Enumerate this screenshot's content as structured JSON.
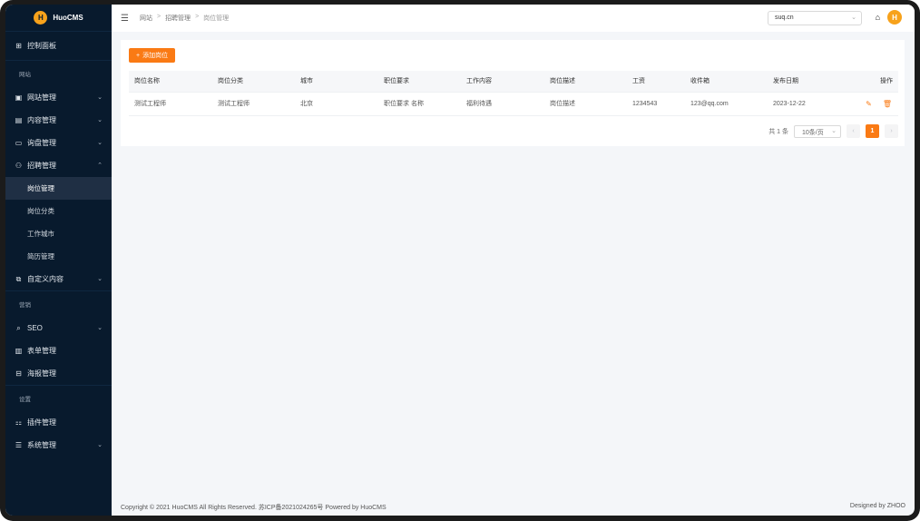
{
  "brand": {
    "name": "HuoCMS",
    "logo_glyph": "H"
  },
  "sidebar": {
    "dashboard": "控制面板",
    "section_site": "网站",
    "site_mgmt": "网站管理",
    "content_mgmt": "内容管理",
    "inquiry_mgmt": "询盘管理",
    "recruit_mgmt": "招聘管理",
    "recruit_children": [
      "岗位管理",
      "岗位分类",
      "工作城市",
      "简历管理"
    ],
    "custom_content": "自定义内容",
    "section_marketing": "营销",
    "seo": "SEO",
    "form_mgmt": "表单管理",
    "poster_mgmt": "海报管理",
    "section_settings": "设置",
    "plugin_mgmt": "插件管理",
    "system_mgmt": "系统管理"
  },
  "header": {
    "breadcrumb": [
      "网站",
      "招聘管理",
      "岗位管理"
    ],
    "site_select": "suq.cn"
  },
  "main": {
    "add_button": "添加岗位",
    "columns": [
      "岗位名称",
      "岗位分类",
      "城市",
      "职位要求",
      "工作内容",
      "岗位描述",
      "工资",
      "收件箱",
      "发布日期",
      "操作"
    ],
    "rows": [
      [
        "测试工程师",
        "测试工程师",
        "北京",
        "职位要求 名称",
        "福利待遇",
        "岗位描述",
        "1234543",
        "123@qq.com",
        "2023-12-22"
      ]
    ]
  },
  "pagination": {
    "total": "共 1 条",
    "page_size": "10条/页",
    "current_page": "1"
  },
  "footer": {
    "copyright": "Copyright © 2021 HuoCMS All Rights Reserved. 苏ICP备2021024265号 Powered by HuoCMS",
    "designed_by": "Designed by ZHOO"
  },
  "colors": {
    "accent": "#fa7a14",
    "sidebar_bg": "#081a2d",
    "brand_logo": "#f7a21b"
  }
}
